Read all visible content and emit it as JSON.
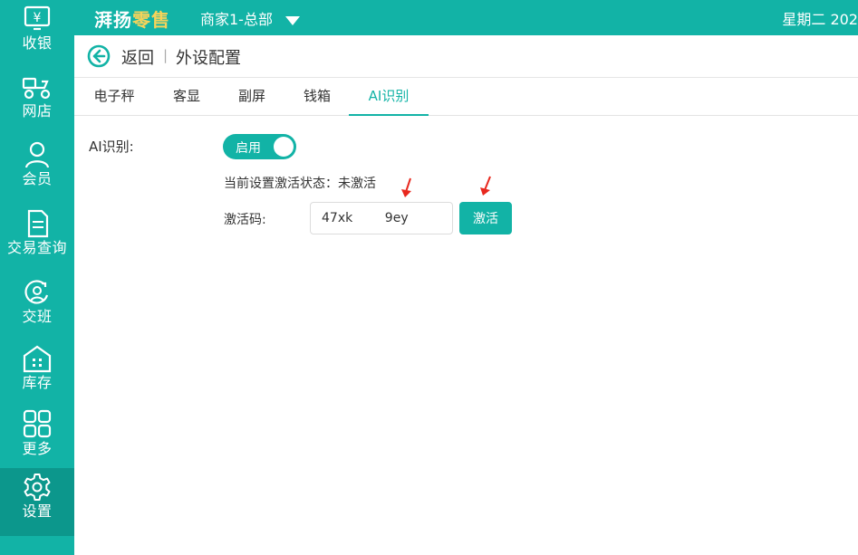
{
  "colors": {
    "accent": "#12b3a6",
    "accent_dark": "#0c978c",
    "brand_highlight": "#f6d35a",
    "annotation": "#e8281e"
  },
  "topbar": {
    "brand_prefix": "湃扬",
    "brand_suffix": "零售",
    "merchant": "商家1-总部",
    "clock": "星期二 202"
  },
  "sidebar": {
    "items": [
      {
        "label": "收银",
        "icon": "cashier-icon"
      },
      {
        "label": "网店",
        "icon": "delivery-scooter-icon"
      },
      {
        "label": "会员",
        "icon": "member-icon"
      },
      {
        "label": "交易查询",
        "icon": "document-icon"
      },
      {
        "label": "交班",
        "icon": "shift-change-icon"
      },
      {
        "label": "库存",
        "icon": "warehouse-icon"
      },
      {
        "label": "更多",
        "icon": "grid-icon"
      },
      {
        "label": "设置",
        "icon": "gear-icon",
        "active": true
      }
    ]
  },
  "breadcrumb": {
    "back": "返回",
    "separator": "|",
    "title": "外设配置"
  },
  "tabs": [
    "电子秤",
    "客显",
    "副屏",
    "钱箱",
    "AI识别"
  ],
  "active_tab": "AI识别",
  "form": {
    "ai_label": "AI识别:",
    "toggle_label": "启用",
    "status_text": "当前设置激活状态：未激活",
    "code_label": "激活码:",
    "code_value": "47xk        9ey",
    "activate_button": "激活"
  }
}
